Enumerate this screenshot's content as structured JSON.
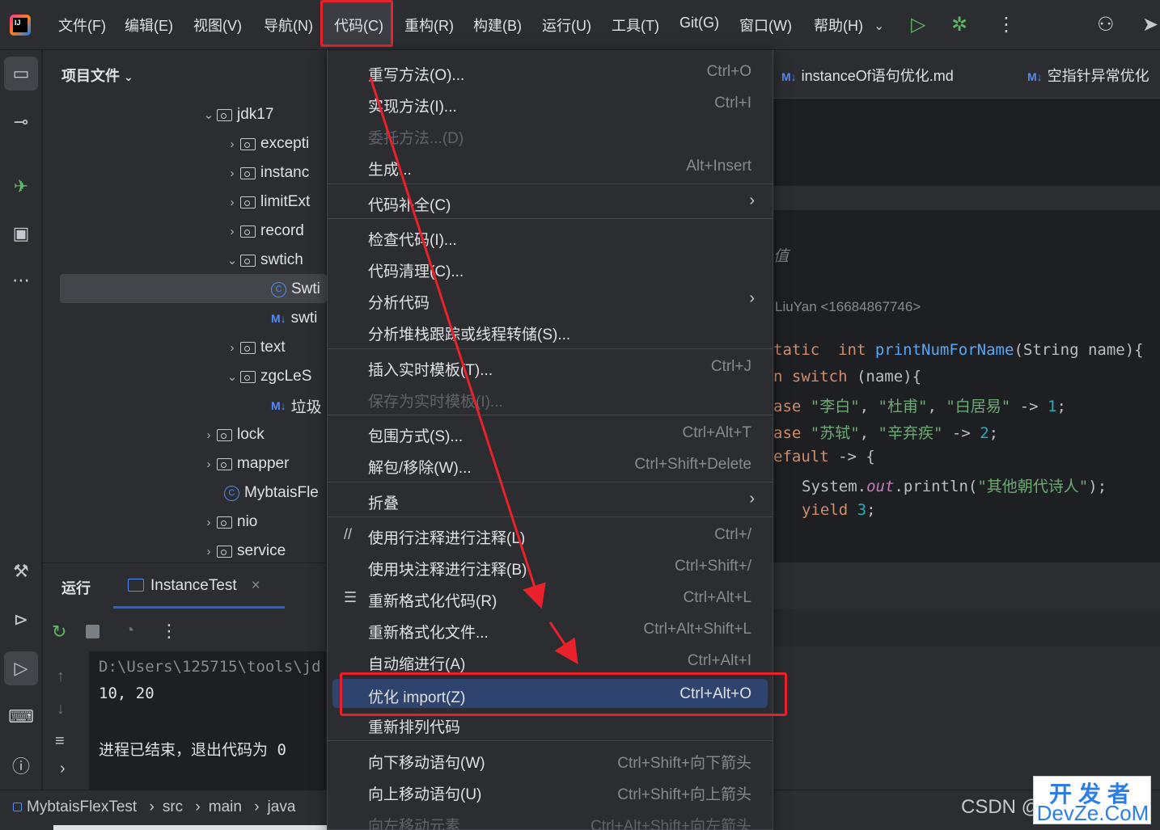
{
  "menubar": {
    "items": [
      "文件(F)",
      "编辑(E)",
      "视图(V)",
      "导航(N)",
      "代码(C)",
      "重构(R)",
      "构建(B)",
      "运行(U)",
      "工具(T)",
      "Git(G)",
      "窗口(W)",
      "帮助(H)"
    ]
  },
  "project": {
    "title": "项目文件",
    "rows": [
      "jdk17",
      "excepti",
      "instanc",
      "limitExt",
      "record",
      "swtich",
      "Swti",
      "swti",
      "text",
      "zgcLeS",
      "垃圾",
      "lock",
      "mapper",
      "MybtaisFle",
      "nio",
      "service"
    ]
  },
  "editor": {
    "tabs": [
      "instanceOf语句优化.md",
      "空指针异常优化"
    ],
    "comment": "值",
    "author": "LiuYan <16684867746>",
    "lines": {
      "l1_kw": "tatic  int ",
      "l1_fn": "printNumForName",
      "l1_rest": "(String name){",
      "l2_kw": "n switch",
      "l2_rest": " (name){",
      "l3_kw": "ase ",
      "l3_s1": "\"李白\"",
      "l3_s2": "\"杜甫\"",
      "l3_s3": "\"白居易\"",
      "l3_arrow": " -> ",
      "l3_num": "1",
      "l3_end": ";",
      "l4_kw": "ase ",
      "l4_s1": "\"苏轼\"",
      "l4_s2": "\"辛弃疾\"",
      "l4_arrow": " -> ",
      "l4_num": "2",
      "l4_end": ";",
      "l5_kw": "efault",
      "l5_rest": " -> {",
      "l6_a": "System.",
      "l6_out": "out",
      "l6_b": ".println(",
      "l6_str": "\"其他朝代诗人\"",
      "l6_c": ");",
      "l7_kw": "yield ",
      "l7_num": "3",
      "l7_end": ";"
    }
  },
  "run": {
    "title": "运行",
    "tab": "InstanceTest",
    "console": [
      "D:\\Users\\125715\\tools\\jd",
      "10, 20",
      "进程已结束，退出代码为 0"
    ]
  },
  "breadcrumb": [
    "MybtaisFlexTest",
    "src",
    "main",
    "java"
  ],
  "code_menu": {
    "items": [
      {
        "label": "重写方法(O)...",
        "shortcut": "Ctrl+O"
      },
      {
        "label": "实现方法(I)...",
        "shortcut": "Ctrl+I"
      },
      {
        "label": "委托方法...(D)",
        "shortcut": ""
      },
      {
        "label": "生成...",
        "shortcut": "Alt+Insert"
      },
      {
        "label": "代码补全(C)",
        "shortcut": ""
      },
      {
        "label": "检查代码(I)...",
        "shortcut": ""
      },
      {
        "label": "代码清理(C)...",
        "shortcut": ""
      },
      {
        "label": "分析代码",
        "shortcut": ""
      },
      {
        "label": "分析堆栈跟踪或线程转储(S)...",
        "shortcut": ""
      },
      {
        "label": "插入实时模板(T)...",
        "shortcut": "Ctrl+J"
      },
      {
        "label": "保存为实时模板(I)...",
        "shortcut": ""
      },
      {
        "label": "包围方式(S)...",
        "shortcut": "Ctrl+Alt+T"
      },
      {
        "label": "解包/移除(W)...",
        "shortcut": "Ctrl+Shift+Delete"
      },
      {
        "label": "折叠",
        "shortcut": ""
      },
      {
        "label": "使用行注释进行注释(L)",
        "shortcut": "Ctrl+/"
      },
      {
        "label": "使用块注释进行注释(B)",
        "shortcut": "Ctrl+Shift+/"
      },
      {
        "label": "重新格式化代码(R)",
        "shortcut": "Ctrl+Alt+L"
      },
      {
        "label": "重新格式化文件...",
        "shortcut": "Ctrl+Alt+Shift+L"
      },
      {
        "label": "自动缩进行(A)",
        "shortcut": "Ctrl+Alt+I"
      },
      {
        "label": "优化 import(Z)",
        "shortcut": "Ctrl+Alt+O"
      },
      {
        "label": "重新排列代码",
        "shortcut": ""
      },
      {
        "label": "向下移动语句(W)",
        "shortcut": "Ctrl+Shift+向下箭头"
      },
      {
        "label": "向上移动语句(U)",
        "shortcut": "Ctrl+Shift+向上箭头"
      },
      {
        "label": "向左移动元素",
        "shortcut": "Ctrl+Alt+Shift+向左箭头"
      }
    ]
  },
  "watermark": {
    "csdn": "CSDN @",
    "top": "开发者",
    "bottom": "DevZe.CoM"
  },
  "colors": {
    "highlight": "#2e436e",
    "annotation_red": "#e8212a",
    "accent_blue": "#548af7"
  }
}
